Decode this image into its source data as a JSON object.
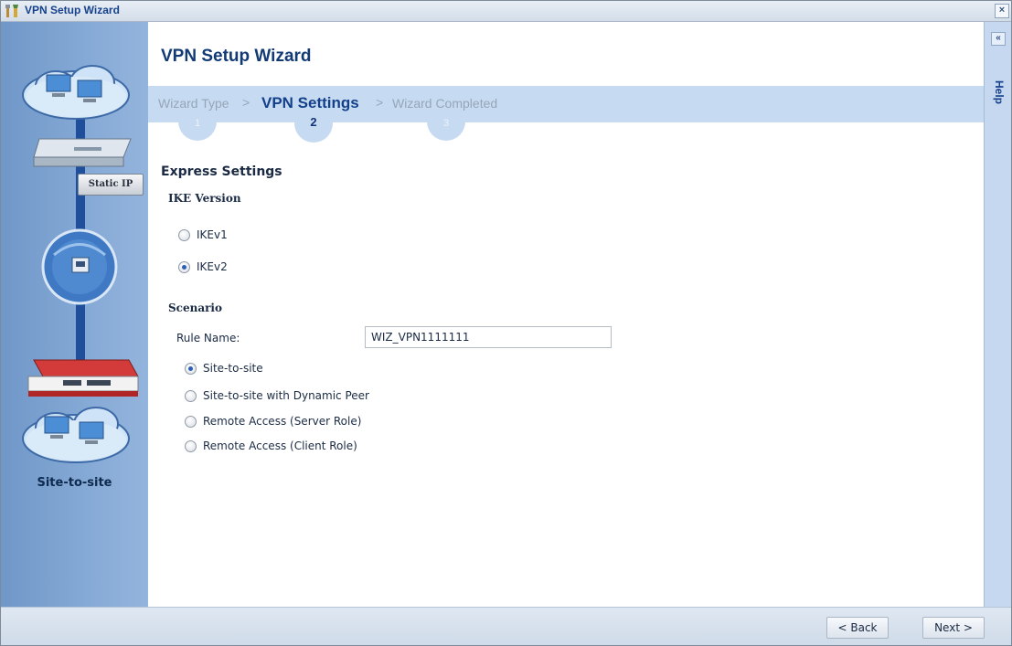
{
  "window": {
    "title": "VPN Setup Wizard",
    "close_glyph": "×"
  },
  "sidebar": {
    "static_ip_tag": "Static IP",
    "scenario_label": "Site-to-site"
  },
  "main": {
    "title": "VPN Setup Wizard",
    "steps": [
      {
        "label": "Wizard Type",
        "number": "1",
        "active": false
      },
      {
        "label": "VPN Settings",
        "number": "2",
        "active": true
      },
      {
        "label": "Wizard Completed",
        "number": "3",
        "active": false
      }
    ],
    "step_separator": ">",
    "express_heading": "Express Settings",
    "ike": {
      "heading": "IKE Version",
      "options": [
        {
          "label": "IKEv1",
          "selected": false
        },
        {
          "label": "IKEv2",
          "selected": true
        }
      ]
    },
    "scenario": {
      "heading": "Scenario",
      "rule_name_label": "Rule Name:",
      "rule_name_value": "WIZ_VPN1111111",
      "options": [
        {
          "label": "Site-to-site",
          "selected": true
        },
        {
          "label": "Site-to-site with Dynamic Peer",
          "selected": false
        },
        {
          "label": "Remote Access (Server Role)",
          "selected": false
        },
        {
          "label": "Remote Access (Client Role)",
          "selected": false
        }
      ]
    }
  },
  "help": {
    "label": "Help",
    "collapse_glyph": "«"
  },
  "footer": {
    "back_label": "< Back",
    "next_label": "Next >"
  },
  "colors": {
    "sidebar": "#7ea3d0",
    "steps_band": "#c6daf1",
    "title": "#123a74",
    "active_step": "#134089"
  }
}
